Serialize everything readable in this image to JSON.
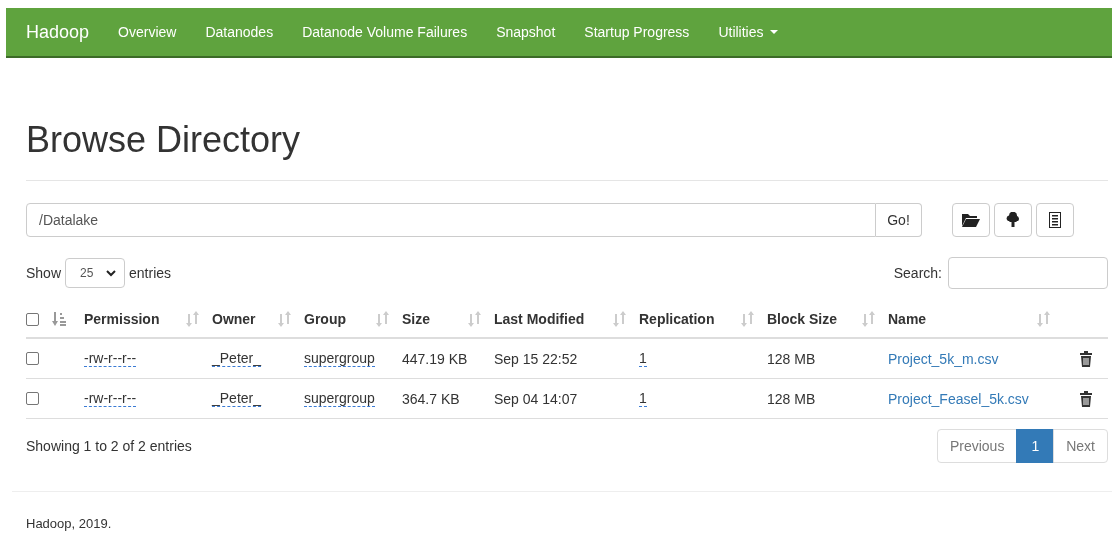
{
  "navbar": {
    "brand": "Hadoop",
    "items": [
      {
        "label": "Overview",
        "dropdown": false
      },
      {
        "label": "Datanodes",
        "dropdown": false
      },
      {
        "label": "Datanode Volume Failures",
        "dropdown": false
      },
      {
        "label": "Snapshot",
        "dropdown": false
      },
      {
        "label": "Startup Progress",
        "dropdown": false
      },
      {
        "label": "Utilities",
        "dropdown": true
      }
    ]
  },
  "page_title": "Browse Directory",
  "path_field": {
    "value": "/Datalake"
  },
  "go_button": "Go!",
  "length": {
    "label_before": "Show",
    "value": "25",
    "label_after": "entries"
  },
  "search": {
    "label": "Search:"
  },
  "table": {
    "select_all": {
      "checked": false
    },
    "columns": [
      {
        "label": "Permission"
      },
      {
        "label": "Owner"
      },
      {
        "label": "Group"
      },
      {
        "label": "Size"
      },
      {
        "label": "Last Modified"
      },
      {
        "label": "Replication"
      },
      {
        "label": "Block Size"
      },
      {
        "label": "Name"
      }
    ],
    "rows": [
      {
        "checked": false,
        "permission": "-rw-r--r--",
        "owner": "_Peter_",
        "group": "supergroup",
        "size": "447.19 KB",
        "last_modified": "Sep 15 22:52",
        "replication": "1",
        "block_size": "128 MB",
        "name": "Project_5k_m.csv"
      },
      {
        "checked": false,
        "permission": "-rw-r--r--",
        "owner": "_Peter_",
        "group": "supergroup",
        "size": "364.7 KB",
        "last_modified": "Sep 04 14:07",
        "replication": "1",
        "block_size": "128 MB",
        "name": "Project_Feasel_5k.csv"
      }
    ]
  },
  "info": "Showing 1 to 2 of 2 entries",
  "pagination": [
    {
      "label": "Previous",
      "selected": false
    },
    {
      "label": "1",
      "selected": true
    },
    {
      "label": "Next",
      "selected": false
    }
  ],
  "footer": "Hadoop, 2019."
}
